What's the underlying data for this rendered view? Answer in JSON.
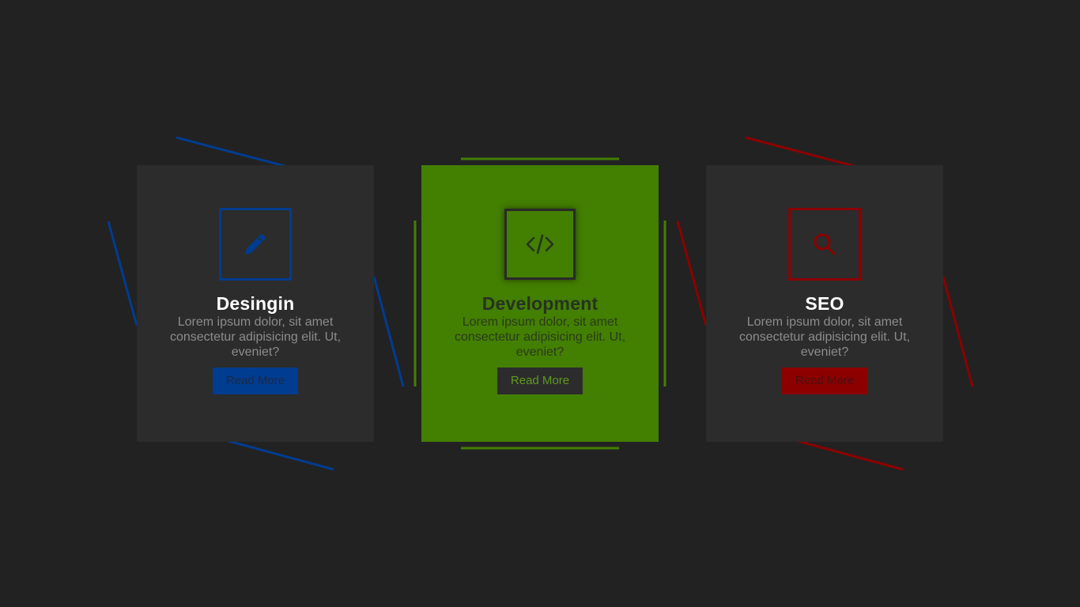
{
  "cards": [
    {
      "title": "Desingin",
      "text": "Lorem ipsum dolor, sit amet consectetur adipisicing elit. Ut, eveniet?",
      "button": "Read More",
      "icon": "pencil-icon",
      "accent": "#003c8f"
    },
    {
      "title": "Development",
      "text": "Lorem ipsum dolor, sit amet consectetur adipisicing elit. Ut, eveniet?",
      "button": "Read More",
      "icon": "code-icon",
      "accent": "#437f00"
    },
    {
      "title": "SEO",
      "text": "Lorem ipsum dolor, sit amet consectetur adipisicing elit. Ut, eveniet?",
      "button": "Read More",
      "icon": "search-icon",
      "accent": "#8c0000"
    }
  ],
  "colors": {
    "background": "#222222",
    "card": "#2c2c2c",
    "muted_text": "#8c8c8c"
  }
}
